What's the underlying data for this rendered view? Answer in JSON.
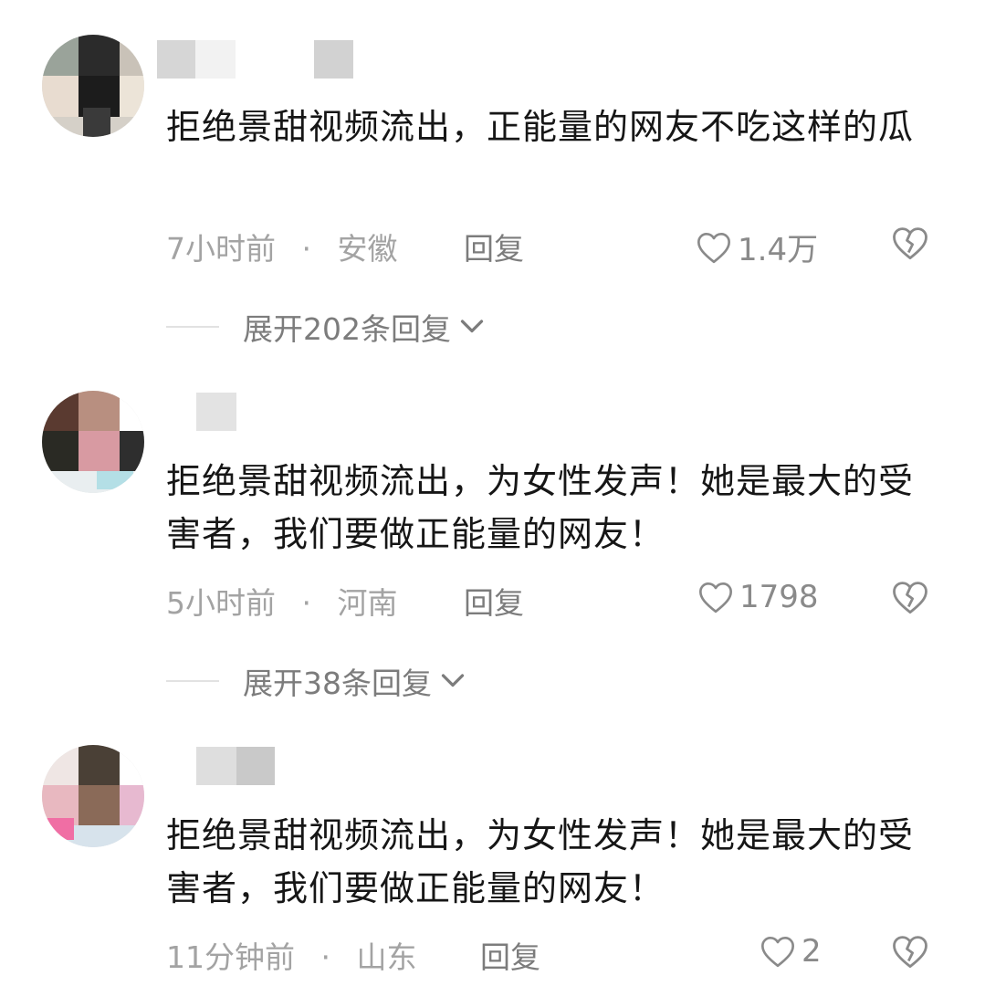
{
  "comments": [
    {
      "text": "拒绝景甜视频流出，正能量的网友不吃这样的瓜",
      "time": "7小时前",
      "dot": "·",
      "location": "安徽",
      "reply_label": "回复",
      "likes": "1.4万",
      "expand_label": "展开202条回复"
    },
    {
      "text": "拒绝景甜视频流出，为女性发声！她是最大的受害者，我们要做正能量的网友！",
      "time": "5小时前",
      "dot": "·",
      "location": "河南",
      "reply_label": "回复",
      "likes": "1798",
      "expand_label": "展开38条回复"
    },
    {
      "text": "拒绝景甜视频流出，为女性发声！她是最大的受害者，我们要做正能量的网友！",
      "time": "11分钟前",
      "dot": "·",
      "location": "山东",
      "reply_label": "回复",
      "likes": "2"
    }
  ],
  "icons": {
    "like": "heart-outline-icon",
    "dislike": "broken-heart-icon",
    "expand": "chevron-down-icon"
  },
  "colors": {
    "meta_text": "#a3a3a3",
    "reply_text": "#7c7c7c",
    "icon": "#8a8a8a"
  }
}
